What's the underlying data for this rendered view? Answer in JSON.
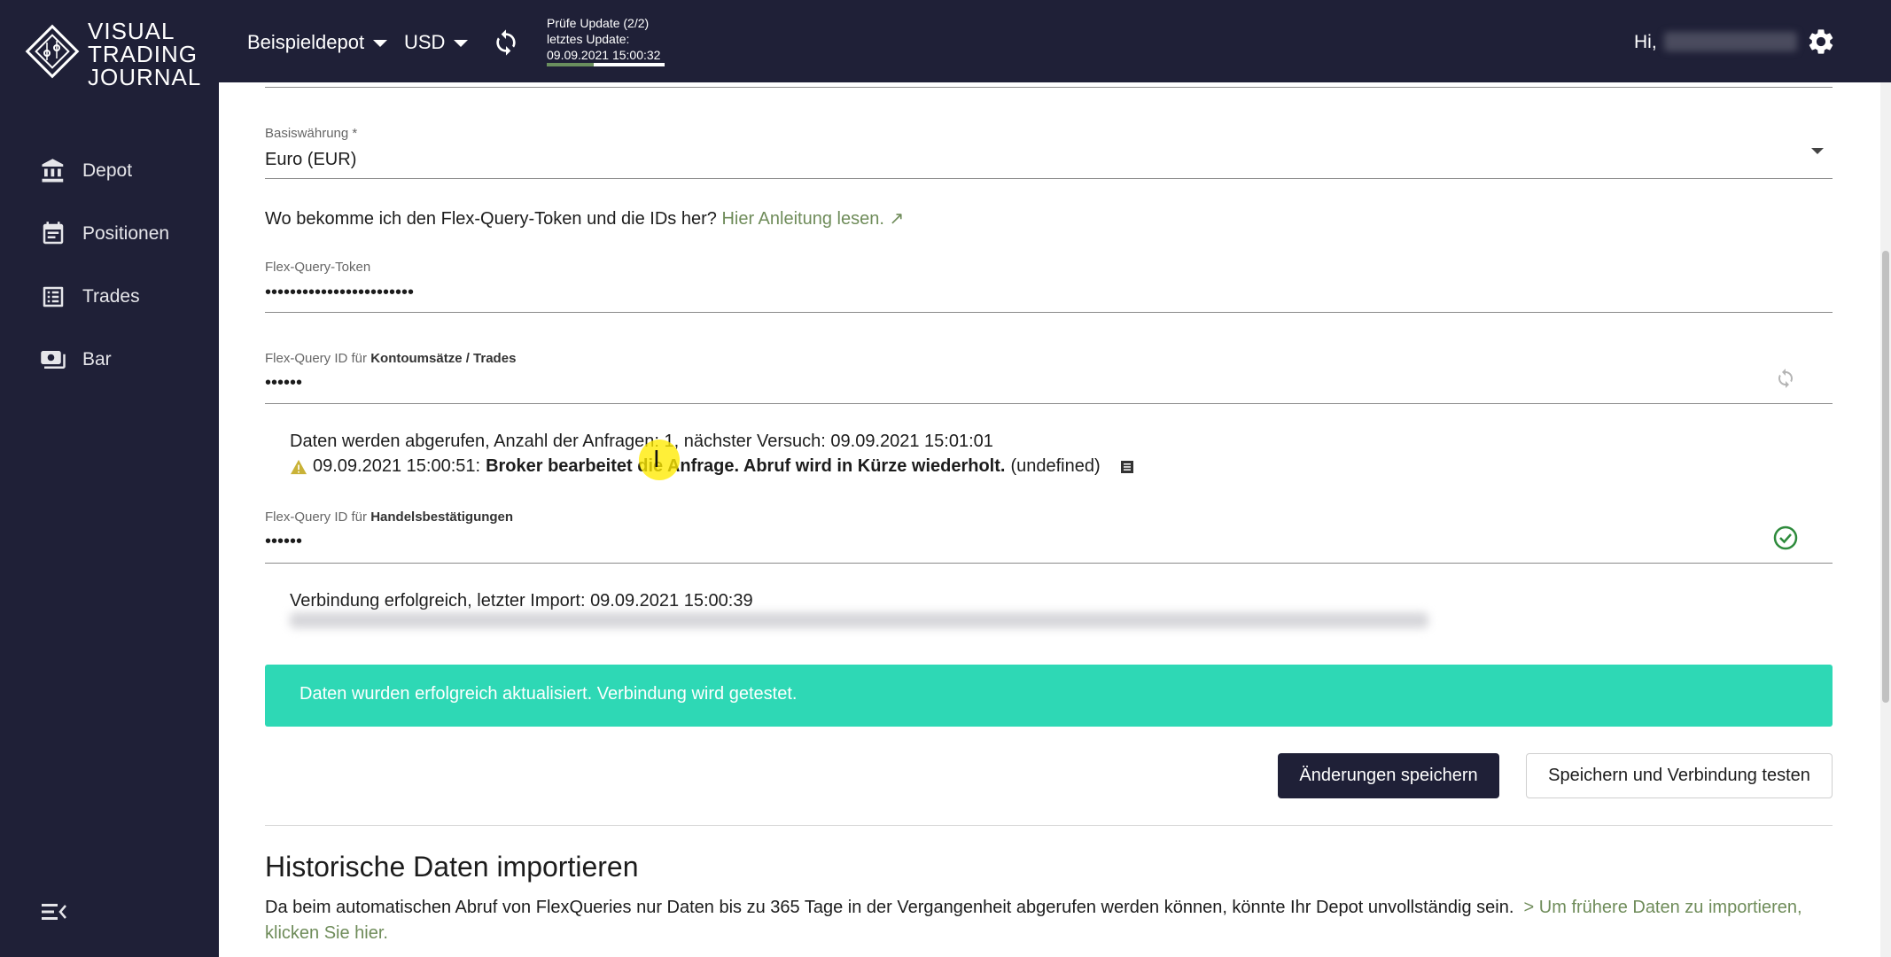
{
  "header": {
    "logo_lines": [
      "VISUAL",
      "TRADING",
      "JOURNAL"
    ],
    "depot_select": "Beispieldepot",
    "currency_select": "USD",
    "update_status_line1": "Prüfe Update (2/2)",
    "update_status_line2": "letztes Update:",
    "update_status_line3": "09.09.2021 15:00:32",
    "update_progress": 0.4,
    "greeting": "Hi,",
    "refresh_icon": "refresh-icon",
    "settings_icon": "gear-icon"
  },
  "sidebar": {
    "items": [
      {
        "label": "Depot",
        "icon": "bank-icon"
      },
      {
        "label": "Positionen",
        "icon": "calendar-list-icon"
      },
      {
        "label": "Trades",
        "icon": "list-icon"
      },
      {
        "label": "Bar",
        "icon": "cash-icon"
      }
    ],
    "collapse_icon": "collapse-menu-icon"
  },
  "form": {
    "base_currency_label": "Basiswährung *",
    "base_currency_value": "Euro (EUR)",
    "help_text": "Wo bekomme ich den Flex-Query-Token und die IDs her?",
    "help_link": "Hier Anleitung lesen. ↗",
    "token_label": "Flex-Query-Token",
    "token_value": "••••••••••••••••••••••••",
    "trades_id_label_prefix": "Flex-Query ID für",
    "trades_id_label_bold": "Kontoumsätze / Trades",
    "trades_id_value": "••••••",
    "trades_status": "Daten werden abgerufen, Anzahl der Anfragen: 1, nächster Versuch: 09.09.2021 15:01:01",
    "trades_warning_time": "09.09.2021 15:00:51:",
    "trades_warning_message": "Broker bearbeitet die Anfrage. Abruf wird in Kürze wiederholt.",
    "trades_warning_suffix": "(undefined)",
    "confirm_id_label_prefix": "Flex-Query ID für",
    "confirm_id_label_bold": "Handelsbestätigungen",
    "confirm_id_value": "••••••",
    "confirm_status": "Verbindung erfolgreich, letzter Import: 09.09.2021 15:00:39"
  },
  "alert": {
    "message": "Daten wurden erfolgreich aktualisiert. Verbindung wird getestet.",
    "color": "#2ed8b5"
  },
  "buttons": {
    "save": "Änderungen speichern",
    "save_and_test": "Speichern und Verbindung testen"
  },
  "historic": {
    "title": "Historische Daten importieren",
    "text": "Da beim automatischen Abruf von FlexQueries nur Daten bis zu 365 Tage in der Vergangenheit abgerufen werden können, könnte Ihr Depot unvollständig sein.",
    "link": "> Um frühere Daten zu importieren, klicken Sie hier."
  },
  "colors": {
    "nav_bg": "#1f2037",
    "accent_green": "#6f8c5a",
    "success": "#2ed8b5"
  }
}
